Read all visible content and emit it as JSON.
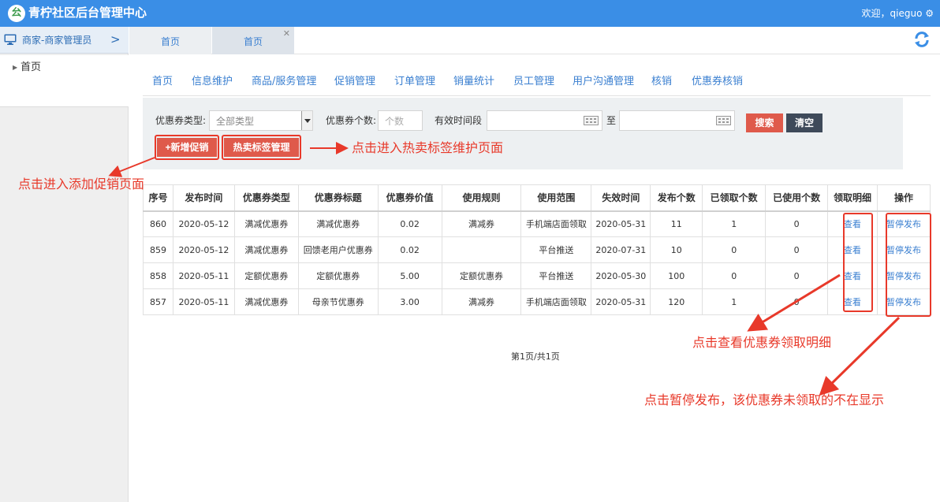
{
  "header": {
    "logo_glyph": "㕕",
    "title": "青柠社区后台管理中心",
    "welcome": "欢迎，qieguo ⚙"
  },
  "sidebar": {
    "merchant_label": "商家-商家管理员",
    "chevron": ">",
    "home_label": "首页"
  },
  "tabs": [
    {
      "label": "首页"
    },
    {
      "label": "首页"
    }
  ],
  "nav": [
    "首页",
    "信息维护",
    "商品/服务管理",
    "促销管理",
    "订单管理",
    "销量统计",
    "员工管理",
    "用户沟通管理",
    "核销",
    "优惠券核销"
  ],
  "filter": {
    "type_label": "优惠券类型:",
    "type_value": "全部类型",
    "count_label": "优惠券个数:",
    "count_placeholder": "个数",
    "period_label": "有效时间段",
    "to_label": "至",
    "search_label": "搜索",
    "clear_label": "清空",
    "add_label": "+新增促销",
    "hot_label": "热卖标签管理"
  },
  "table": {
    "headers": [
      "序号",
      "发布时间",
      "优惠券类型",
      "优惠券标题",
      "优惠券价值",
      "使用规则",
      "使用范围",
      "失效时间",
      "发布个数",
      "已领取个数",
      "已使用个数",
      "领取明细",
      "操作"
    ],
    "rows": [
      [
        "860",
        "2020-05-12",
        "满减优惠券",
        "满减优惠券",
        "0.02",
        "满减券",
        "手机端店面领取",
        "2020-05-31",
        "11",
        "1",
        "0",
        "查看",
        "暂停发布"
      ],
      [
        "859",
        "2020-05-12",
        "满减优惠券",
        "回馈老用户优惠券",
        "0.02",
        "",
        "平台推送",
        "2020-07-31",
        "10",
        "0",
        "0",
        "查看",
        "暂停发布"
      ],
      [
        "858",
        "2020-05-11",
        "定额优惠券",
        "定额优惠券",
        "5.00",
        "定额优惠券",
        "平台推送",
        "2020-05-30",
        "100",
        "0",
        "0",
        "查看",
        "暂停发布"
      ],
      [
        "857",
        "2020-05-11",
        "满减优惠券",
        "母亲节优惠券",
        "3.00",
        "满减券",
        "手机端店面领取",
        "2020-05-31",
        "120",
        "1",
        "0",
        "查看",
        "暂停发布"
      ]
    ]
  },
  "pager": "第1页/共1页",
  "annotations": {
    "hot_tag": "点击进入热卖标签维护页面",
    "add_promo": "点击进入添加促销页面",
    "view_detail": "点击查看优惠券领取明细",
    "pause": "点击暂停发布，该优惠券未领取的不在显示"
  },
  "colors": {
    "header_blue": "#3a8ee6",
    "accent_red": "#df5a4b",
    "annotation_red": "#e8392a",
    "link_blue": "#3a7fd0"
  }
}
